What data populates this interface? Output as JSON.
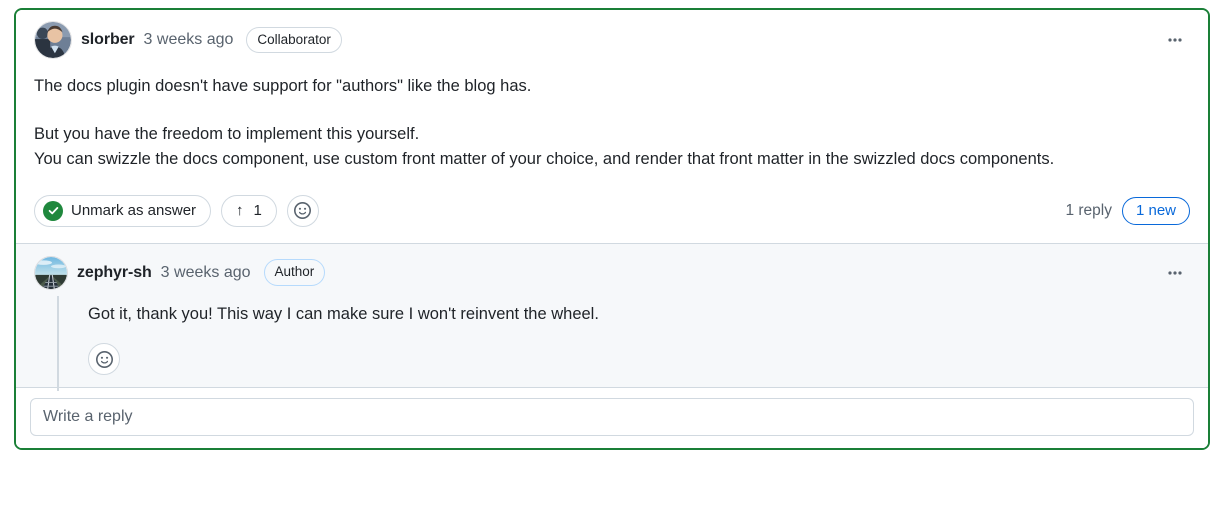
{
  "colors": {
    "answer_border": "#1a7f37",
    "check_badge": "#1f883d",
    "new_pill": "#0969da",
    "muted_text": "#59636e",
    "reply_background": "#f6f8fa",
    "card_border": "#d1d9e0"
  },
  "answer": {
    "author": "slorber",
    "timestamp": "3 weeks ago",
    "badge": "Collaborator",
    "paragraphs": [
      "The docs plugin doesn't have support for \"authors\" like the blog has.",
      "But you have the freedom to implement this yourself.\nYou can swizzle the docs component, use custom front matter of your choice, and render that front matter in the swizzled docs components."
    ],
    "line1": "The docs plugin doesn't have support for \"authors\" like the blog has.",
    "line2": "But you have the freedom to implement this yourself.",
    "line3": "You can swizzle the docs component, use custom front matter of your choice, and render that front matter in the swizzled docs components.",
    "actions": {
      "unmark_label": "Unmark as answer",
      "upvote_arrow": "↑",
      "upvote_count": "1",
      "emoji_icon": "smiley-icon",
      "reply_count": "1 reply",
      "new_badge": "1 new"
    },
    "menu_icon": "kebab-horizontal-icon"
  },
  "reply": {
    "author": "zephyr-sh",
    "timestamp": "3 weeks ago",
    "badge": "Author",
    "text": "Got it, thank you! This way I can make sure I won't reinvent the wheel.",
    "emoji_icon": "smiley-icon",
    "menu_icon": "kebab-horizontal-icon"
  },
  "reply_form": {
    "placeholder": "Write a reply",
    "value": ""
  }
}
